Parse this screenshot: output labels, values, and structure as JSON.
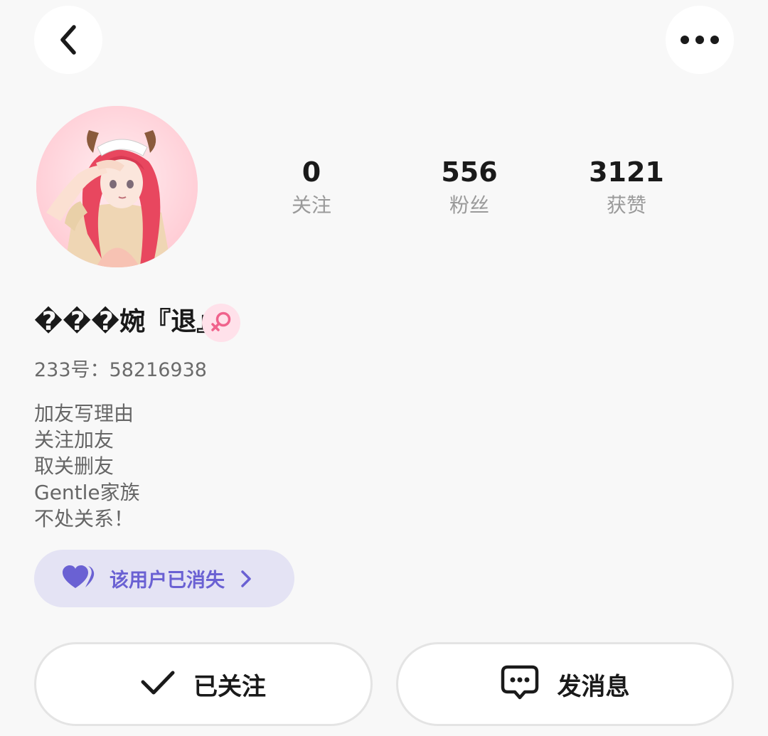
{
  "header": {
    "back_icon": "chevron-left-icon",
    "more_icon": "more-horizontal-icon"
  },
  "profile": {
    "avatar_icon": "avatar-image",
    "stats": [
      {
        "value": "0",
        "label": "关注"
      },
      {
        "value": "556",
        "label": "粉丝"
      },
      {
        "value": "3121",
        "label": "获赞"
      }
    ],
    "nickname": "���婉『退』",
    "gender_icon": "female-icon",
    "id_text": "233号：58216938",
    "bio": [
      "加友写理由",
      "关注加友",
      "取关删友",
      "Gentle家族",
      "不处关系！"
    ]
  },
  "status_pill": {
    "icon": "heart-icon",
    "label": "该用户已消失",
    "chevron_icon": "chevron-right-icon",
    "accent_color": "#6a61d3",
    "background_color": "#e4e3f4"
  },
  "actions": {
    "follow_label": "已关注",
    "follow_icon": "checkmark-icon",
    "message_label": "发消息",
    "message_icon": "chat-bubble-icon"
  }
}
